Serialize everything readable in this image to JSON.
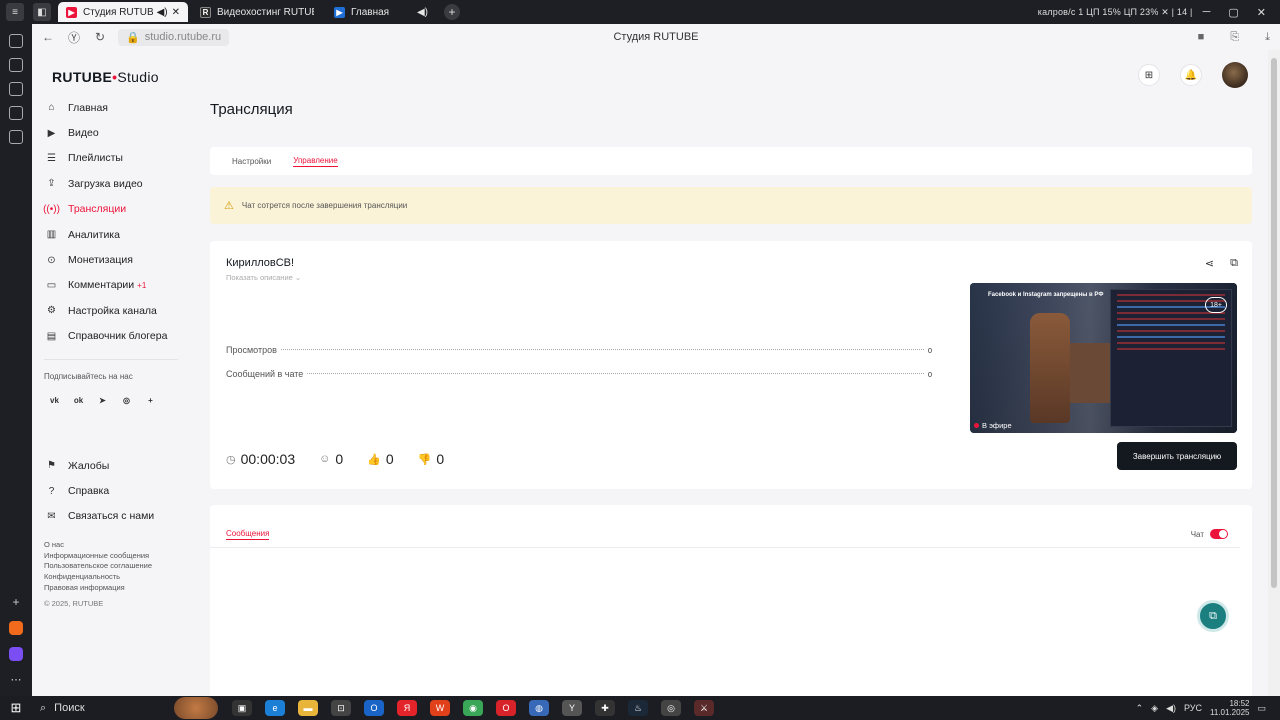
{
  "browser": {
    "tabs": [
      {
        "label": "Студия RUTUBE",
        "active": true
      },
      {
        "label": "Видеохостинг RUTUBE. Смотрит",
        "active": false
      },
      {
        "label": "Главная",
        "active": false
      }
    ],
    "sysinfo": "калров/с  1  ЦП 15% ЦП 23%  ✕ |  14 |",
    "url": "studio.rutube.ru",
    "page_title": "Студия RUTUBE"
  },
  "studio": {
    "logo_main": "RUTUBE",
    "logo_sub": "Studio",
    "nav": [
      {
        "label": "Главная",
        "icon": "home-icon"
      },
      {
        "label": "Видео",
        "icon": "video-icon"
      },
      {
        "label": "Плейлисты",
        "icon": "list-icon"
      },
      {
        "label": "Загрузка видео",
        "icon": "upload-icon"
      },
      {
        "label": "Трансляции",
        "icon": "broadcast-icon",
        "active": true
      },
      {
        "label": "Аналитика",
        "icon": "chart-icon"
      },
      {
        "label": "Монетизация",
        "icon": "coin-icon"
      },
      {
        "label": "Комментарии",
        "icon": "comment-icon",
        "badge": "+1"
      },
      {
        "label": "Настройка канала",
        "icon": "gear-icon"
      },
      {
        "label": "Справочник блогера",
        "icon": "book-icon"
      }
    ],
    "subscribe_label": "Подписывайтесь на нас",
    "socials": [
      "vk",
      "ok",
      "telegram",
      "viber",
      "plus"
    ],
    "bottom_nav": [
      {
        "label": "Жалобы",
        "icon": "flag-icon"
      },
      {
        "label": "Справка",
        "icon": "help-icon"
      },
      {
        "label": "Связаться с нами",
        "icon": "mail-icon"
      }
    ],
    "footer_links": [
      "О нас",
      "Информационные сообщения",
      "Пользовательское соглашение",
      "Конфиденциальность",
      "Правовая информация"
    ],
    "copyright": "© 2025, RUTUBE"
  },
  "page": {
    "title": "Трансляция",
    "tabs": [
      "Настройки",
      "Управление"
    ],
    "warning": "Чат сотрется после завершения трансляции",
    "stream": {
      "title": "КирилловСВ!",
      "show_description": "Показать описание",
      "stats": [
        {
          "label": "Просмотров",
          "value": "0"
        },
        {
          "label": "Сообщений в чате",
          "value": "0"
        }
      ],
      "duration": "00:00:03",
      "viewers": "0",
      "likes": "0",
      "dislikes": "0",
      "preview_title": "Facebook и Instagram запрещены в РФ",
      "age_rating": "18+",
      "on_air": "В эфире",
      "end_button": "Завершить трансляцию"
    },
    "chat": {
      "messages_tab": "Сообщения",
      "chat_label": "Чат",
      "chat_enabled": true
    }
  },
  "taskbar": {
    "search": "Поиск",
    "lang": "РУС",
    "time": "18:52",
    "date": "11.01.2025"
  },
  "colors": {
    "accent": "#ed143b",
    "dark": "#14191f",
    "warning_bg": "#fbf3d8"
  }
}
